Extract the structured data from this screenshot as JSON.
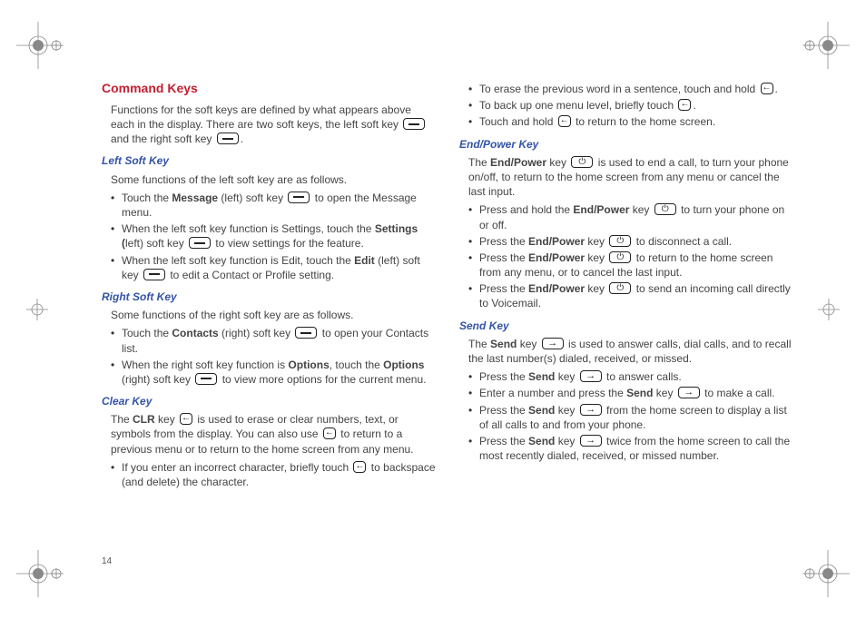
{
  "pageNumber": "14",
  "col1": {
    "heading": "Command Keys",
    "intro_a": "Functions for the soft keys are defined by what appears above each in the display. There are two soft keys, the left soft key ",
    "intro_b": " and the right soft key ",
    "intro_c": ".",
    "left": {
      "title": "Left Soft Key",
      "intro": "Some functions of the left soft key are as follows.",
      "b1_a": "Touch the ",
      "b1_bold": "Message",
      "b1_b": " (left) soft key ",
      "b1_c": " to open the Message menu.",
      "b2_a": "When the left soft key function is Settings, touch the ",
      "b2_bold": "Settings (",
      "b2_b": "left) soft key ",
      "b2_c": " to view settings for the feature.",
      "b3_a": "When the left soft key function is Edit, touch the ",
      "b3_bold": "Edit",
      "b3_b": " (left) soft key ",
      "b3_c": " to edit a Contact or Profile setting."
    },
    "right": {
      "title": "Right Soft Key",
      "intro": "Some functions of the right soft key are as follows.",
      "b1_a": "Touch the ",
      "b1_bold": "Contacts",
      "b1_b": " (right) soft key ",
      "b1_c": " to open your Contacts list.",
      "b2_a": "When the right soft key function is ",
      "b2_bold": "Options",
      "b2_b": ", touch the ",
      "b2_bold2": "Options",
      "b2_c": " (right) soft key ",
      "b2_d": " to view more options for the current menu."
    },
    "clear": {
      "title": "Clear Key",
      "p_a": "The ",
      "p_bold": "CLR",
      "p_b": " key ",
      "p_c": " is used to erase or clear numbers, text, or symbols from the display. You can also use ",
      "p_d": " to return to a previous menu or to return to the home screen from any menu.",
      "b1_a": "If you enter an incorrect character, briefly touch ",
      "b1_b": " to backspace (and delete) the character."
    }
  },
  "col2": {
    "clear_cont": {
      "b2_a": "To erase the previous word in a sentence, touch and hold ",
      "b2_b": ".",
      "b3_a": "To back up one menu level, briefly touch ",
      "b3_b": ".",
      "b4_a": "Touch and hold ",
      "b4_b": " to return to the home screen."
    },
    "end": {
      "title": "End/Power Key",
      "p_a": "The ",
      "p_bold": "End/Power",
      "p_b": " key ",
      "p_c": " is used to end a call, to turn your phone on/off, to return to the home screen from any menu or cancel the last input.",
      "b1_a": "Press and hold the ",
      "b1_bold": "End/Power",
      "b1_b": " key ",
      "b1_c": " to turn your phone on or off.",
      "b2_a": "Press the ",
      "b2_bold": "End/Power",
      "b2_b": " key ",
      "b2_c": " to disconnect a call.",
      "b3_a": "Press the ",
      "b3_bold": "End/Power",
      "b3_b": " key ",
      "b3_c": " to return to the home screen from any menu, or to cancel the last input.",
      "b4_a": "Press the ",
      "b4_bold": "End/Power",
      "b4_b": " key ",
      "b4_c": " to send an incoming call directly to Voicemail."
    },
    "send": {
      "title": "Send Key",
      "p_a": "The ",
      "p_bold": "Send",
      "p_b": " key ",
      "p_c": " is used to answer calls, dial calls, and to recall the last number(s) dialed, received, or missed.",
      "b1_a": "Press the ",
      "b1_bold": "Send",
      "b1_b": " key ",
      "b1_c": " to answer calls.",
      "b2_a": "Enter a number and press the ",
      "b2_bold": "Send",
      "b2_b": " key ",
      "b2_c": " to make a call.",
      "b3_a": "Press the ",
      "b3_bold": "Send",
      "b3_b": " key ",
      "b3_c": " from the home screen to display a list of all calls to and from your phone.",
      "b4_a": "Press the ",
      "b4_bold": "Send",
      "b4_b": " key ",
      "b4_c": " twice from the home screen to call the most recently dialed, received, or missed number."
    }
  }
}
